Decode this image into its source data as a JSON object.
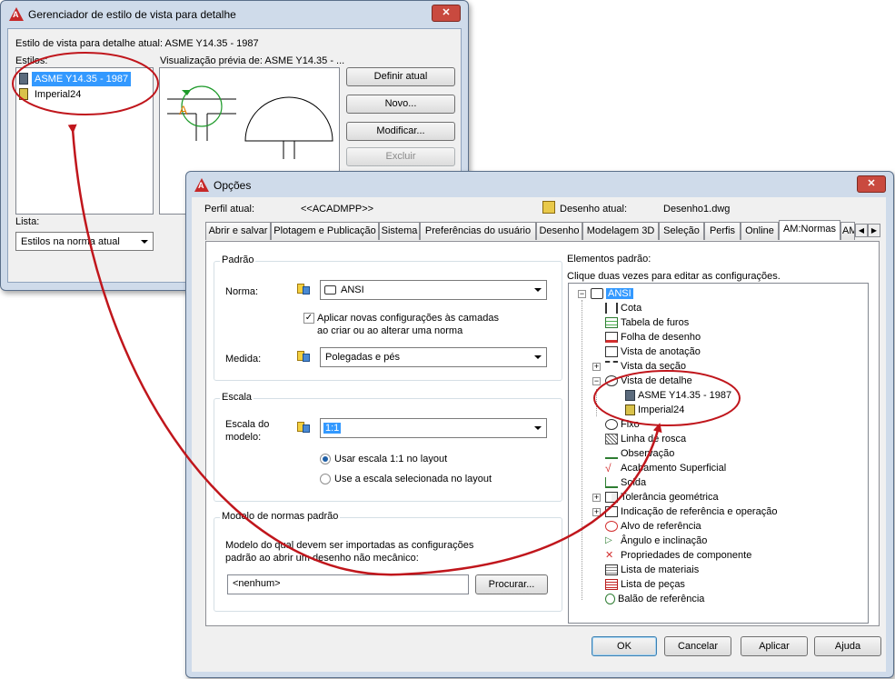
{
  "mgr": {
    "title": "Gerenciador de estilo de vista para detalhe",
    "current_label": "Estilo de vista para detalhe atual: ASME Y14.35 - 1987",
    "styles_label": "Estilos:",
    "styles": [
      "ASME Y14.35 - 1987",
      "Imperial24"
    ],
    "preview_label": "Visualização prévia de: ASME Y14.35 - ...",
    "preview_letter": "A",
    "btn_set_current": "Definir atual",
    "btn_new": "Novo...",
    "btn_modify": "Modificar...",
    "btn_delete": "Excluir",
    "list_label": "Lista:",
    "list_value": "Estilos na norma atual"
  },
  "opt": {
    "title": "Opções",
    "profile_label": "Perfil atual:",
    "profile_value": "<<ACADMPP>>",
    "drawing_label": "Desenho atual:",
    "drawing_value": "Desenho1.dwg",
    "tabs": [
      "Abrir e salvar",
      "Plotagem e Publicação",
      "Sistema",
      "Preferências do usuário",
      "Desenho",
      "Modelagem 3D",
      "Seleção",
      "Perfis",
      "Online",
      "AM:Normas",
      "AM"
    ],
    "padrao": {
      "title": "Padrão",
      "norma_label": "Norma:",
      "norma_value": "ANSI",
      "apply_line1": "Aplicar novas configurações às camadas",
      "apply_line2": "ao criar ou ao alterar uma norma",
      "medida_label": "Medida:",
      "medida_value": "Polegadas e pés"
    },
    "escala": {
      "title": "Escala",
      "label_line1": "Escala do",
      "label_line2": "modelo:",
      "value": "1:1",
      "radio1": "Usar escala 1:1 no layout",
      "radio2": "Use a escala selecionada no layout"
    },
    "modelo": {
      "title": "Modelo de normas padrão",
      "desc_line1": "Modelo do qual devem ser importadas as configurações",
      "desc_line2": "padrão ao abrir um desenho não mecânico:",
      "value": "<nenhum>",
      "browse": "Procurar..."
    },
    "tree_title": "Elementos padrão:",
    "tree_hint": "Clique duas vezes para editar as configurações.",
    "tree": {
      "root": "ANSI",
      "items": [
        "Cota",
        "Tabela de furos",
        "Folha de desenho",
        "Vista de anotação",
        "Vista da seção",
        "Vista de detalhe",
        "ASME Y14.35 - 1987",
        "Imperial24",
        "Fixo",
        "Linha de rosca",
        "Observação",
        "Acabamento Superficial",
        "Solda",
        "Tolerância geométrica",
        "Indicação de referência e operação",
        "Alvo de referência",
        "Ângulo e inclinação",
        "Propriedades de componente",
        "Lista de materiais",
        "Lista de peças",
        "Balão de referência"
      ]
    },
    "buttons": {
      "ok": "OK",
      "cancel": "Cancelar",
      "apply": "Aplicar",
      "help": "Ajuda"
    }
  },
  "colors": {
    "annotation": "#c0161c",
    "selection": "#3399ff"
  }
}
